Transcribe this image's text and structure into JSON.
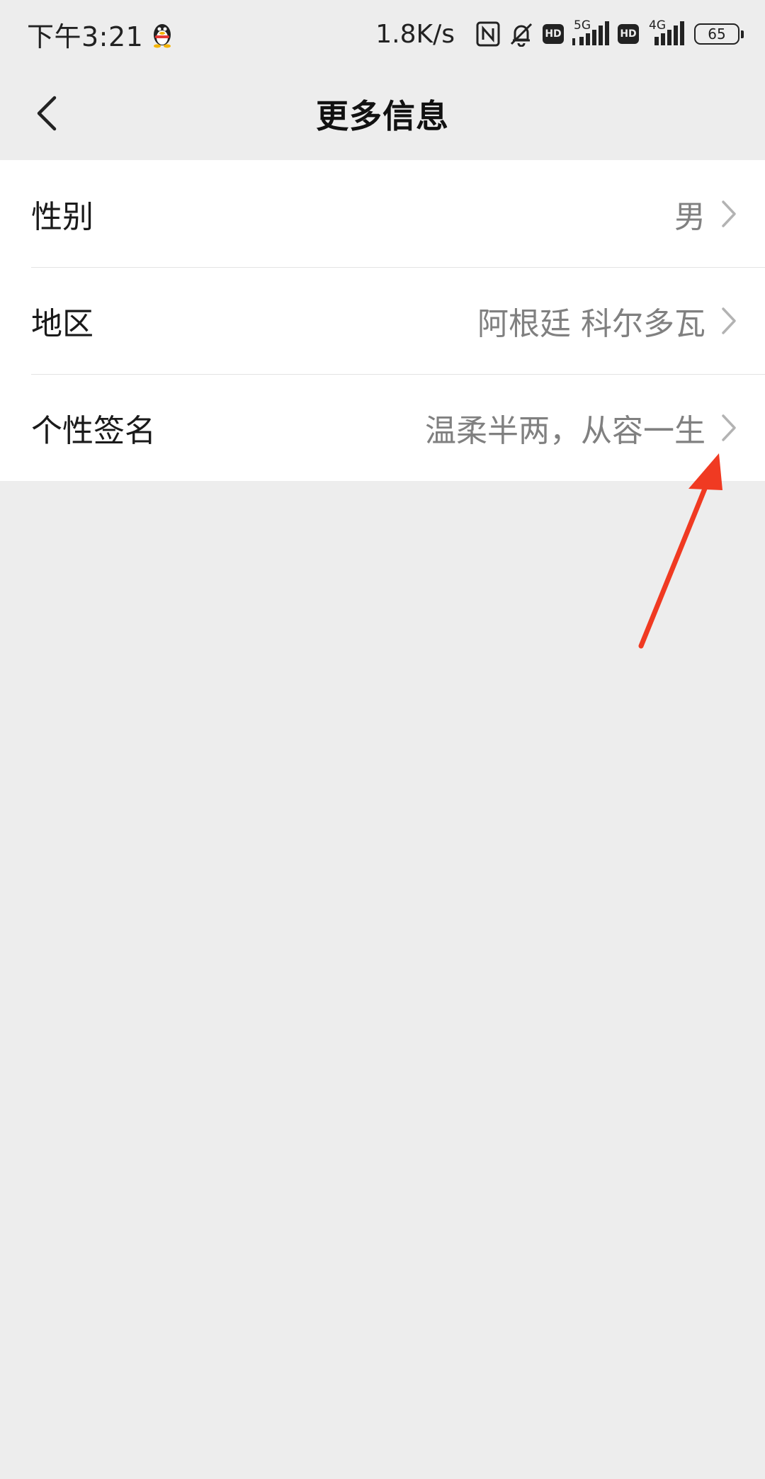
{
  "status_bar": {
    "time": "下午3:21",
    "net_speed": "1.8K/s",
    "hd_label": "HD",
    "net_1": "5G",
    "net_2": "4G",
    "battery": "65"
  },
  "nav": {
    "title": "更多信息",
    "back_icon": "chevron-left-icon"
  },
  "rows": [
    {
      "label": "性别",
      "value": "男"
    },
    {
      "label": "地区",
      "value": "阿根廷 科尔多瓦"
    },
    {
      "label": "个性签名",
      "value": "温柔半两，从容一生"
    }
  ],
  "colors": {
    "background": "#ededed",
    "card": "#ffffff",
    "value_text": "#808080",
    "annotation_arrow": "#f03a22"
  }
}
